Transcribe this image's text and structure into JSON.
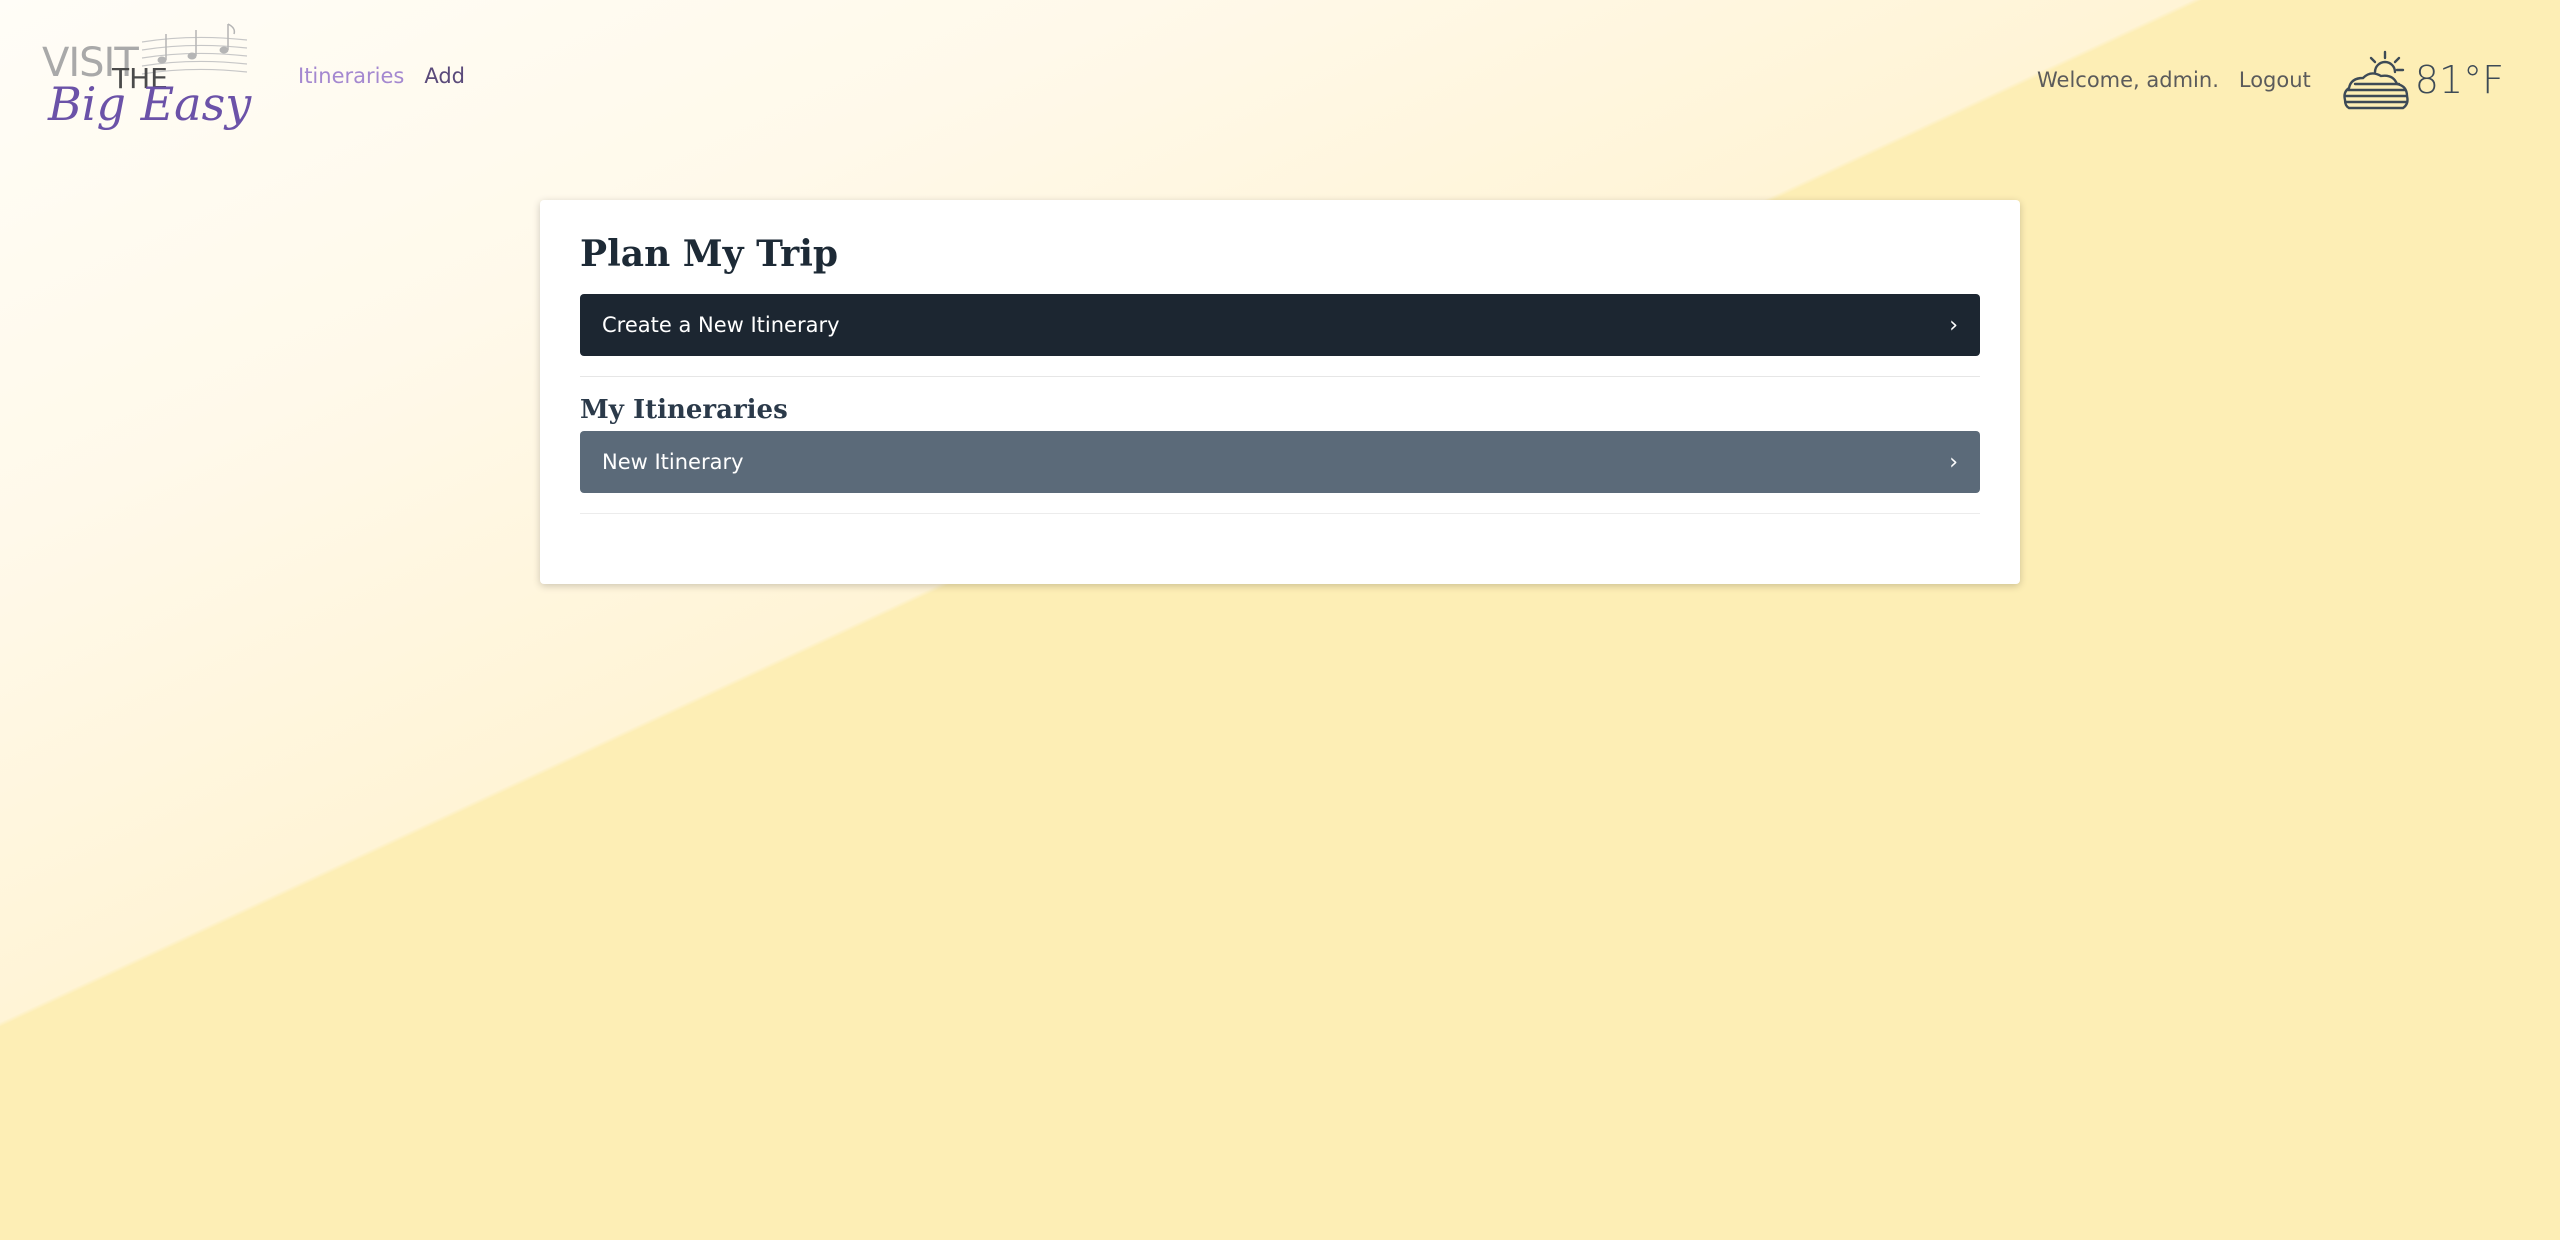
{
  "header": {
    "logo": {
      "text_visit": "VISIT",
      "text_the": "THE",
      "text_name": "Big Easy"
    },
    "nav": [
      {
        "label": "Itineraries",
        "active": true
      },
      {
        "label": "Add",
        "active": false
      }
    ],
    "welcome_text": "Welcome, admin.",
    "logout_label": "Logout",
    "weather": {
      "icon": "sunset-cloud-icon",
      "temperature": "81°F"
    }
  },
  "card": {
    "title": "Plan My Trip",
    "create_label": "Create a New Itinerary",
    "section_title": "My Itineraries",
    "itineraries": [
      {
        "label": "New Itinerary"
      }
    ]
  },
  "colors": {
    "brand_purple": "#6b52a8",
    "nav_active": "#a488d0",
    "dark_button": "#1c2631",
    "slate_button": "#5b6a79",
    "background": "#fdeeb5"
  }
}
